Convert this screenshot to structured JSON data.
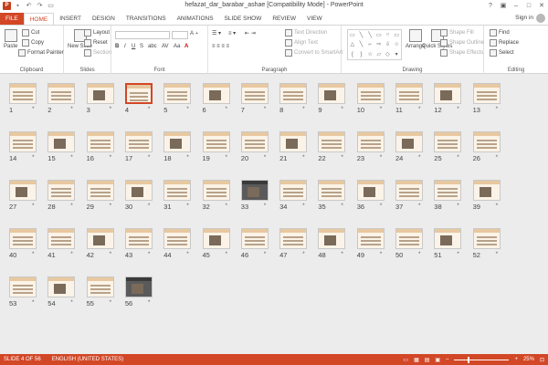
{
  "window": {
    "title": "hefazat_dar_barabar_ashae [Compatibility Mode] - PowerPoint",
    "signin": "Sign in"
  },
  "qat": [
    "save-icon",
    "undo-icon",
    "redo-icon",
    "start-slideshow-icon"
  ],
  "tabs": [
    "FILE",
    "HOME",
    "INSERT",
    "DESIGN",
    "TRANSITIONS",
    "ANIMATIONS",
    "SLIDE SHOW",
    "REVIEW",
    "VIEW"
  ],
  "active_tab": "HOME",
  "ribbon": {
    "clipboard": {
      "label": "Clipboard",
      "paste": "Paste",
      "cut": "Cut",
      "copy": "Copy",
      "format_painter": "Format Painter"
    },
    "slides": {
      "label": "Slides",
      "new_slide": "New Slide",
      "layout": "Layout",
      "reset": "Reset",
      "section": "Section"
    },
    "font": {
      "label": "Font",
      "bold": "B",
      "italic": "I",
      "underline": "U",
      "strike": "S",
      "shadow": "abc",
      "spacing": "AV",
      "case": "Aa",
      "color": "A"
    },
    "paragraph": {
      "label": "Paragraph",
      "text_direction": "Text Direction",
      "align_text": "Align Text",
      "convert_smartart": "Convert to SmartArt"
    },
    "drawing": {
      "label": "Drawing",
      "arrange": "Arrange",
      "quick_styles": "Quick Styles",
      "shape_fill": "Shape Fill",
      "shape_outline": "Shape Outline",
      "shape_effects": "Shape Effects"
    },
    "editing": {
      "label": "Editing",
      "find": "Find",
      "replace": "Replace",
      "select": "Select"
    }
  },
  "slides": {
    "count": 56,
    "selected": 4,
    "star": "*",
    "labels": [
      "1",
      "2",
      "3",
      "4",
      "5",
      "6",
      "7",
      "8",
      "9",
      "10",
      "11",
      "12",
      "13",
      "14",
      "15",
      "16",
      "17",
      "18",
      "19",
      "20",
      "21",
      "22",
      "23",
      "24",
      "25",
      "26",
      "27",
      "28",
      "29",
      "30",
      "31",
      "32",
      "33",
      "34",
      "35",
      "36",
      "37",
      "38",
      "39",
      "40",
      "41",
      "42",
      "43",
      "44",
      "45",
      "46",
      "47",
      "48",
      "49",
      "50",
      "51",
      "52",
      "53",
      "54",
      "55",
      "56"
    ]
  },
  "status": {
    "slide": "SLIDE 4 OF 56",
    "language": "ENGLISH (UNITED STATES)",
    "zoom": "25%",
    "zoom_level": 0.25
  }
}
